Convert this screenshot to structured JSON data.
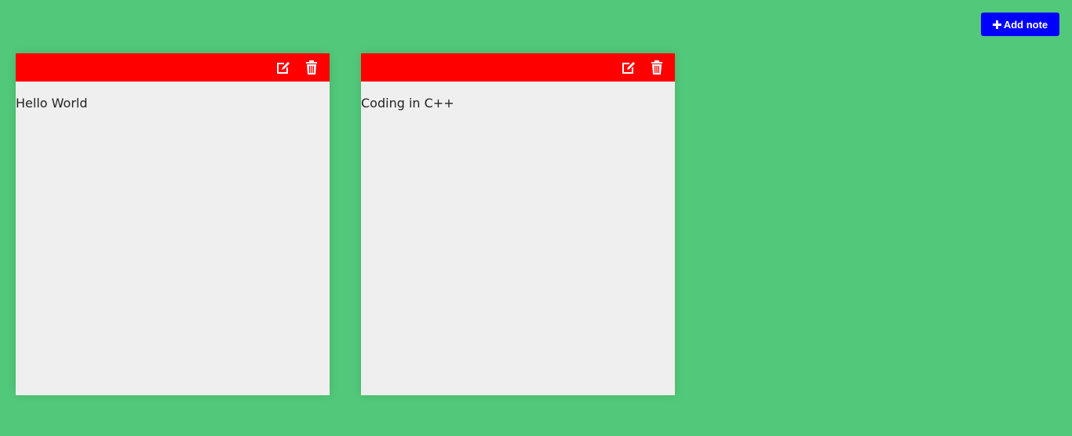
{
  "header": {
    "add_button_label": "Add note",
    "add_button_icon": "plus-icon",
    "add_button_color": "#0000ff"
  },
  "theme": {
    "background": "#52c97a",
    "toolbar_color": "#ff0000",
    "note_color": "#efefef"
  },
  "notes": [
    {
      "text": "Hello World",
      "edit_icon": "edit-icon",
      "delete_icon": "trash-icon"
    },
    {
      "text": "Coding in C++",
      "edit_icon": "edit-icon",
      "delete_icon": "trash-icon"
    }
  ]
}
